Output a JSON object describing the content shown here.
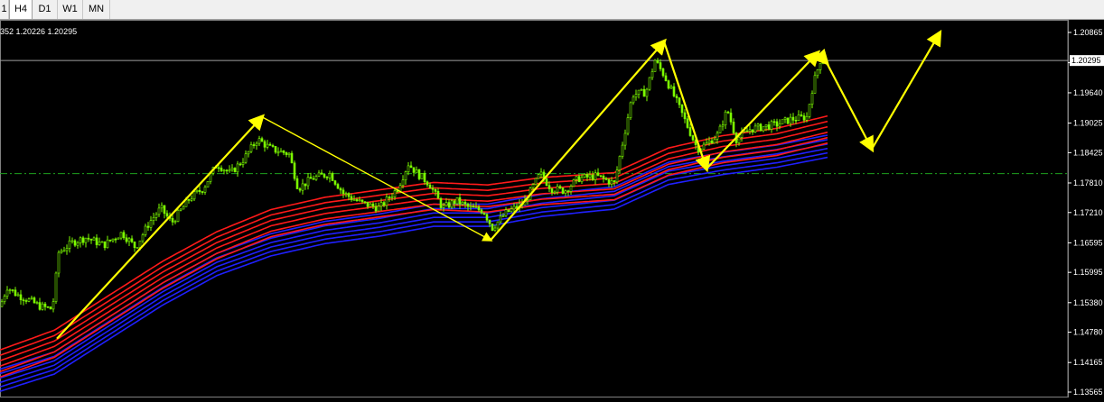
{
  "timeframes": [
    {
      "label": "1",
      "active": false
    },
    {
      "label": "H4",
      "active": true
    },
    {
      "label": "D1",
      "active": false
    },
    {
      "label": "W1",
      "active": false
    },
    {
      "label": "MN",
      "active": false
    }
  ],
  "ohlc_text": "352 1.20226 1.20295",
  "colors": {
    "background": "#000000",
    "bull_candle": "#7CFC00",
    "ma_red": "#ff1a1a",
    "ma_blue": "#2020ff",
    "zigzag": "#ffff00",
    "level_line": "#1ea01e",
    "bid_line": "#a0a0a0"
  },
  "chart_data": {
    "type": "candlestick",
    "instrument_hint": "",
    "price_axis": {
      "ticks": [
        1.20865,
        1.2025,
        1.1964,
        1.19025,
        1.18425,
        1.1781,
        1.1721,
        1.16595,
        1.15995,
        1.1538,
        1.1478,
        1.14165,
        1.13565
      ],
      "tick_labels": [
        "1.20865",
        "1.2025",
        "1.19640",
        "1.19025",
        "1.18425",
        "1.17810",
        "1.17210",
        "1.16595",
        "1.15995",
        "1.15380",
        "1.14780",
        "1.14165",
        "1.13565"
      ],
      "range": [
        1.135,
        1.2113
      ]
    },
    "current_price": 1.20295,
    "current_price_label": "1.20295",
    "horizontal_level": 1.18,
    "close_path": [
      [
        0,
        1.153
      ],
      [
        8,
        1.157
      ],
      [
        18,
        1.1555
      ],
      [
        30,
        1.1545
      ],
      [
        45,
        1.153
      ],
      [
        58,
        1.1525
      ],
      [
        65,
        1.164
      ],
      [
        80,
        1.166
      ],
      [
        95,
        1.167
      ],
      [
        115,
        1.1655
      ],
      [
        135,
        1.168
      ],
      [
        150,
        1.165
      ],
      [
        165,
        1.17
      ],
      [
        178,
        1.173
      ],
      [
        190,
        1.17
      ],
      [
        210,
        1.175
      ],
      [
        225,
        1.177
      ],
      [
        240,
        1.182
      ],
      [
        255,
        1.18
      ],
      [
        270,
        1.183
      ],
      [
        285,
        1.187
      ],
      [
        300,
        1.185
      ],
      [
        320,
        1.184
      ],
      [
        330,
        1.177
      ],
      [
        345,
        1.179
      ],
      [
        365,
        1.18
      ],
      [
        380,
        1.176
      ],
      [
        400,
        1.174
      ],
      [
        420,
        1.173
      ],
      [
        440,
        1.177
      ],
      [
        452,
        1.182
      ],
      [
        462,
        1.18
      ],
      [
        475,
        1.178
      ],
      [
        490,
        1.173
      ],
      [
        505,
        1.1745
      ],
      [
        520,
        1.173
      ],
      [
        535,
        1.1725
      ],
      [
        545,
        1.169
      ],
      [
        560,
        1.172
      ],
      [
        580,
        1.174
      ],
      [
        598,
        1.18
      ],
      [
        610,
        1.177
      ],
      [
        625,
        1.1765
      ],
      [
        640,
        1.179
      ],
      [
        660,
        1.1795
      ],
      [
        680,
        1.178
      ],
      [
        690,
        1.187
      ],
      [
        700,
        1.196
      ],
      [
        715,
        1.1965
      ],
      [
        725,
        1.203
      ],
      [
        735,
        1.2
      ],
      [
        748,
        1.195
      ],
      [
        760,
        1.19
      ],
      [
        772,
        1.185
      ],
      [
        782,
        1.186
      ],
      [
        795,
        1.188
      ],
      [
        805,
        1.193
      ],
      [
        815,
        1.187
      ],
      [
        830,
        1.189
      ],
      [
        845,
        1.1895
      ],
      [
        860,
        1.19
      ],
      [
        875,
        1.191
      ],
      [
        893,
        1.1915
      ],
      [
        900,
        1.198
      ],
      [
        908,
        1.203
      ],
      [
        916,
        1.203
      ]
    ],
    "ma_red_center": [
      [
        0,
        1.142
      ],
      [
        60,
        1.146
      ],
      [
        120,
        1.153
      ],
      [
        180,
        1.16
      ],
      [
        240,
        1.166
      ],
      [
        300,
        1.1705
      ],
      [
        360,
        1.173
      ],
      [
        420,
        1.1745
      ],
      [
        480,
        1.176
      ],
      [
        540,
        1.1755
      ],
      [
        600,
        1.177
      ],
      [
        680,
        1.178
      ],
      [
        740,
        1.183
      ],
      [
        800,
        1.1855
      ],
      [
        860,
        1.187
      ],
      [
        916,
        1.1895
      ]
    ],
    "ma_blue_center": [
      [
        0,
        1.1385
      ],
      [
        60,
        1.142
      ],
      [
        120,
        1.149
      ],
      [
        180,
        1.156
      ],
      [
        240,
        1.162
      ],
      [
        300,
        1.166
      ],
      [
        360,
        1.1685
      ],
      [
        420,
        1.17
      ],
      [
        480,
        1.172
      ],
      [
        540,
        1.172
      ],
      [
        600,
        1.174
      ],
      [
        680,
        1.1755
      ],
      [
        740,
        1.1805
      ],
      [
        800,
        1.1825
      ],
      [
        860,
        1.184
      ],
      [
        916,
        1.186
      ]
    ],
    "zigzag_points": [
      [
        63,
        1.1465
      ],
      [
        290,
        1.1915
      ],
      [
        543,
        1.1665
      ],
      [
        735,
        1.2068
      ],
      [
        782,
        1.181
      ],
      [
        905,
        1.2045
      ],
      [
        915,
        1.2025
      ],
      [
        965,
        1.185
      ],
      [
        1040,
        1.2085
      ]
    ]
  }
}
